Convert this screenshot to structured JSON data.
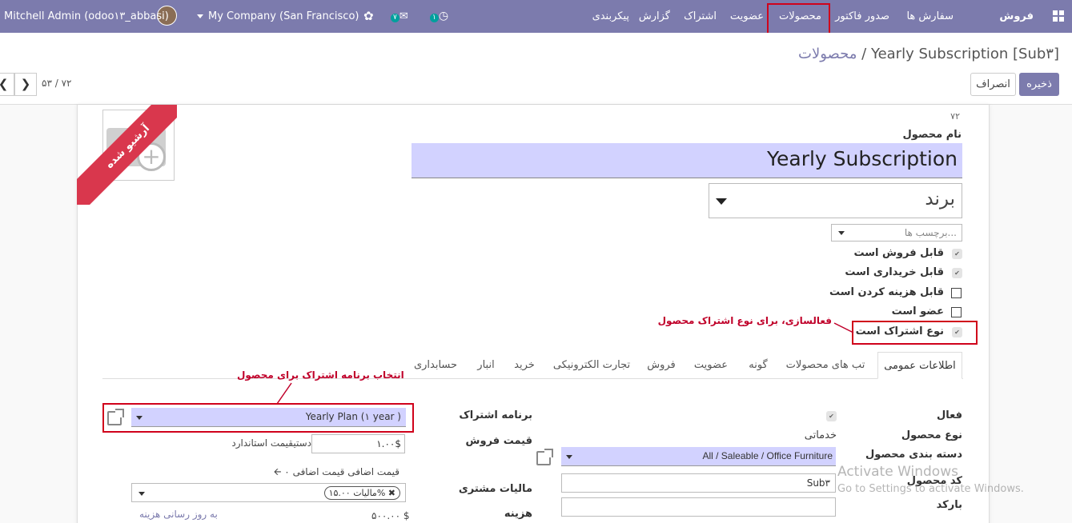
{
  "navbar": {
    "brand": "فروش",
    "menu": [
      "سفارش ها",
      "صدور فاکتور",
      "محصولات",
      "عضویت",
      "اشتراک",
      "گزارش",
      "پیکربندی"
    ],
    "company": "My Company (San Francisco)",
    "user": "Mitchell Admin (odoo۱۳_abbasi)",
    "chat_count": "۷",
    "activity_count": "۱"
  },
  "breadcrumb": {
    "parent": "محصولات",
    "separator": "/",
    "current": "Yearly Subscription [Sub۳]"
  },
  "buttons": {
    "save": "ذخیره",
    "discard": "انصراف"
  },
  "pager": {
    "text": "۵۳ / ۷۲"
  },
  "ribbon": "آرشیو شده",
  "form": {
    "record_id": "۷۲",
    "name_label": "نام محصول",
    "name_value": "Yearly Subscription",
    "brand_placeholder": "برند",
    "tags_placeholder": "برچسب ها...",
    "checks": [
      {
        "label": "قابل فروش است",
        "checked": true
      },
      {
        "label": "قابل خریداری است",
        "checked": true
      },
      {
        "label": "قابل هزینه کردن است",
        "checked": false
      },
      {
        "label": "عضو است",
        "checked": false
      },
      {
        "label": "نوع اشتراک است",
        "checked": true
      }
    ]
  },
  "annotations": {
    "subscription_type": "فعالسازی، برای نوع اشتراک محصول",
    "subscription_plan": "انتخاب برنامه اشتراک برای محصول"
  },
  "tabs": [
    "اطلاعات عمومی",
    "تب های محصولات",
    "گونه",
    "عضویت",
    "فروش",
    "تجارت الکترونیکی",
    "خرید",
    "انبار",
    "حسابداری"
  ],
  "general": {
    "active_label": "فعال",
    "product_type_label": "نوع محصول",
    "product_type_value": "خدماتی",
    "category_label": "دسته بندی محصول",
    "category_value": "All / Saleable / Office Furniture",
    "ref_label": "کد محصول",
    "ref_value": "Sub۳",
    "barcode_label": "بارکد",
    "plan_label": "برنامه اشتراک",
    "plan_value": "Yearly Plan (۱ year )",
    "price_label": "قیمت فروش",
    "price_value": "۱.۰۰$",
    "price_note": "دستیقیمت استاندارد",
    "extra_price": "۰ قیمت اضافی قیمت اضافی",
    "tax_label": "مالیات مشتری",
    "tax_tag": "مالیات ۱۵.۰۰%",
    "cost_label": "هزینه",
    "cost_value": "۵۰۰.۰۰ $",
    "cost_note": "به روز رسانی هزینه"
  },
  "watermark": {
    "line1": "Activate Windows",
    "line2": "Go to Settings to activate Windows."
  }
}
